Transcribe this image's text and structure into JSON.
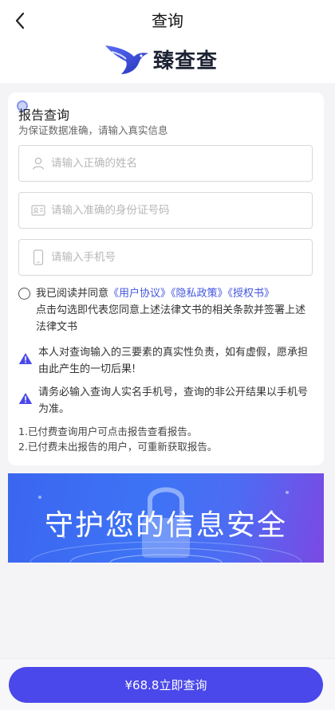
{
  "header": {
    "title": "查询",
    "brand": "臻查查"
  },
  "form": {
    "title": "报告查询",
    "subtitle": "为保证数据准确，请输入真实信息",
    "name_placeholder": "请输入正确的姓名",
    "id_placeholder": "请输入准确的身份证号码",
    "phone_placeholder": "请输入手机号"
  },
  "agreement": {
    "prefix": "我已阅读并同意",
    "user_protocol": "《用户协议》",
    "privacy_policy": "《隐私政策》",
    "authorization": "《授权书》",
    "note": "点击勾选即代表您同意上述法律文书的相关条款并签署上述法律文书"
  },
  "warnings": [
    "本人对查询输入的三要素的真实性负责，如有虚假，愿承担由此产生的一切后果!",
    "请务必输入查询人实名手机号，查询的非公开结果以手机号为准。"
  ],
  "notes": [
    "1.已付费查询用户可点击报告查看报告。",
    "2.已付费未出报告的用户，可重新获取报告。"
  ],
  "banner": {
    "text": "守护您的信息安全"
  },
  "cta": {
    "label": "¥68.8立即查询"
  },
  "colors": {
    "accent": "#4a48ea",
    "link": "#4256e0",
    "warning": "#4a48ea"
  }
}
